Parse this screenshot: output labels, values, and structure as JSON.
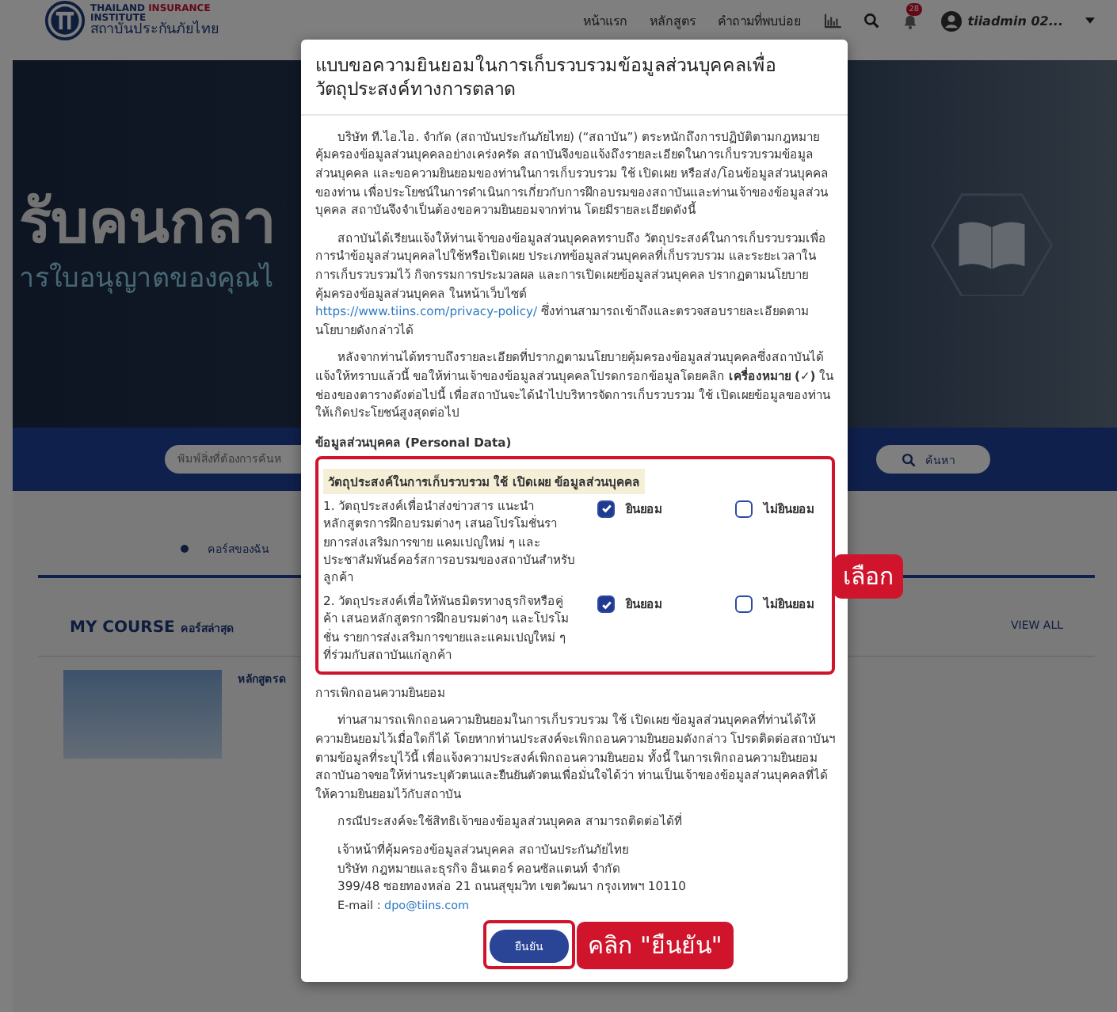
{
  "header": {
    "logo": {
      "line_1": "THAILAND",
      "line_1_accent": "INSURANCE",
      "line_2": "INSTITUTE",
      "line_3": "สถาบันประกันภัยไทย"
    },
    "nav": [
      "หน้าแรก",
      "หลักสูตร",
      "คำถามที่พบบ่อย"
    ],
    "notification_count": "28",
    "user": "tiiadmin 02..."
  },
  "hero": {
    "headline": "รับคนกลา",
    "subline": "ารใบอนุญาตของคุณไ"
  },
  "search": {
    "placeholder": "พิมพ์สิ่งที่ต้องการค้นห",
    "button": "ค้นหา"
  },
  "tabs": [
    {
      "label": "คอร์สของฉัน",
      "selected": true
    }
  ],
  "my_course": {
    "title": "MY COURSE",
    "subtitle": "คอร์สล่าสุด",
    "view_all": "VIEW ALL",
    "course_title": "หลักสูตรด"
  },
  "modal": {
    "title": "แบบขอความยินยอมในการเก็บรวบรวมข้อมูลส่วนบุคคลเพื่อวัตถุประสงค์ทางการตลาด",
    "paragraphs": [
      {
        "text": "บริษัท ที.ไอ.ไอ. จำกัด (สถาบันประกันภัยไทย) (“สถาบัน”) ตระหนักถึงการปฏิบัติตามกฎหมายคุ้มครองข้อมูลส่วนบุคคลอย่างเคร่งครัด สถาบันจึงขอแจ้งถึงรายละเอียดในการเก็บรวบรวมข้อมูลส่วนบุคคล และขอความยินยอมของท่านในการเก็บรวบรวม ใช้ เปิดเผย หรือส่ง/โอนข้อมูลส่วนบุคคลของท่าน เพื่อประโยชน์ในการดำเนินการเกี่ยวกับการฝึกอบรมของสถาบันและท่านเจ้าของข้อมูลส่วนบุคคล สถาบันจึงจำเป็นต้องขอความยินยอมจากท่าน โดยมีรายละเอียดดังนี้"
      },
      {
        "text": "สถาบันได้เรียนแจ้งให้ท่านเจ้าของข้อมูลส่วนบุคคลทราบถึง วัตถุประสงค์ในการเก็บรวบรวมเพื่อการนำข้อมูลส่วนบุคคลไปใช้หรือเปิดเผย ประเภทข้อมูลส่วนบุคคลที่เก็บรวบรวม และระยะเวลาในการเก็บรวบรวมไว้ กิจกรรมการประมวลผล และการเปิดเผยข้อมูลส่วนบุคคล ปรากฏตามนโยบายคุ้มครองข้อมูลส่วนบุคคล ในหน้าเว็บไซต์",
        "link": "https://www.tiins.com/privacy-policy/",
        "text_after": " ซึ่งท่านสามารถเข้าถึงและตรวจสอบรายละเอียดตามนโยบายดังกล่าวได้"
      },
      {
        "text": "หลังจากท่านได้ทราบถึงรายละเอียดที่ปรากฏตามนโยบายคุ้มครองข้อมูลส่วนบุคคลซึ่งสถาบันได้แจ้งให้ทราบแล้วนี้ ขอให้ท่านเจ้าของข้อมูลส่วนบุคคลโปรดกรอกข้อมูลโดยคลิก **เครื่องหมาย (✓)** ในช่องของตารางดังต่อไปนี้ เพื่อสถาบันจะได้นำไปบริหารจัดการเก็บรวบรวม ใช้ เปิดเผยข้อมูลของท่านให้เกิดประโยชน์สูงสุดต่อไป"
      }
    ],
    "personal_data_heading": "ข้อมูลส่วนบุคคล (Personal Data)",
    "consent_table": {
      "heading": "วัตถุประสงค์ในการเก็บรวบรวม ใช้ เปิดเผย ข้อมูลส่วนบุคคล",
      "rows": [
        {
          "text": "1. วัตถุประสงค์เพื่อนำส่งข่าวสาร แนะนำหลักสูตรการฝึกอบรมต่างๆ เสนอโปรโมชั่นรายการส่งเสริมการขาย แคมเปญใหม่ ๆ และประชาสัมพันธ์คอร์สการอบรมของสถาบันสำหรับลูกค้า",
          "options": [
            {
              "label": "ยินยอม",
              "checked": true
            },
            {
              "label": "ไม่ยินยอม",
              "checked": false
            }
          ]
        },
        {
          "text": "2. วัตถุประสงค์เพื่อให้พันธมิตรทางธุรกิจหรือคู่ค้า เสนอหลักสูตรการฝึกอบรมต่างๆ และโปรโมชั่น รายการส่งเสริมการขายและแคมเปญใหม่ ๆ ที่ร่วมกับสถาบันแก่ลูกค้า",
          "options": [
            {
              "label": "ยินยอม",
              "checked": true
            },
            {
              "label": "ไม่ยินยอม",
              "checked": false
            }
          ]
        }
      ]
    },
    "withdraw_heading": "การเพิกถอนความยินยอม",
    "withdraw_paragraphs": [
      "ท่านสามารถเพิกถอนความยินยอมในการเก็บรวบรวม ใช้ เปิดเผย ข้อมูลส่วนบุคคลที่ท่านได้ให้ความยินยอมไว้เมื่อใดก็ได้ โดยหากท่านประสงค์จะเพิกถอนความยินยอมดังกล่าว โปรดติดต่อสถาบันฯตามข้อมูลที่ระบุไว้นี้ เพื่อแจ้งความประสงค์เพิกถอนความยินยอม ทั้งนี้ ในการเพิกถอนความยินยอม สถาบันอาจขอให้ท่านระบุตัวตนและยืนยันตัวตนเพื่อมั่นใจได้ว่า ท่านเป็นเจ้าของข้อมูลส่วนบุคคลที่ได้ให้ความยินยอมไว้กับสถาบัน",
      "กรณีประสงค์จะใช้สิทธิเจ้าของข้อมูลส่วนบุคคล สามารถติดต่อได้ที่"
    ],
    "contact_lines": [
      "เจ้าหน้าที่คุ้มครองข้อมูลส่วนบุคคล สถาบันประกันภัยไทย",
      "บริษัท กฎหมายและธุรกิจ อินเตอร์ คอนซัลแตนท์ จำกัด",
      "399/48 ซอยทองหล่อ 21 ถนนสุขุมวิท เขตวัฒนา กรุงเทพฯ 10110"
    ],
    "email": {
      "label": "E-mail :",
      "value": "dpo@tiins.com"
    },
    "confirm_button": "ยืนยัน"
  },
  "annotations": [
    {
      "kind": "select",
      "text": "เลือก"
    },
    {
      "kind": "click",
      "text": "คลิก \"ยืนยัน\""
    }
  ]
}
